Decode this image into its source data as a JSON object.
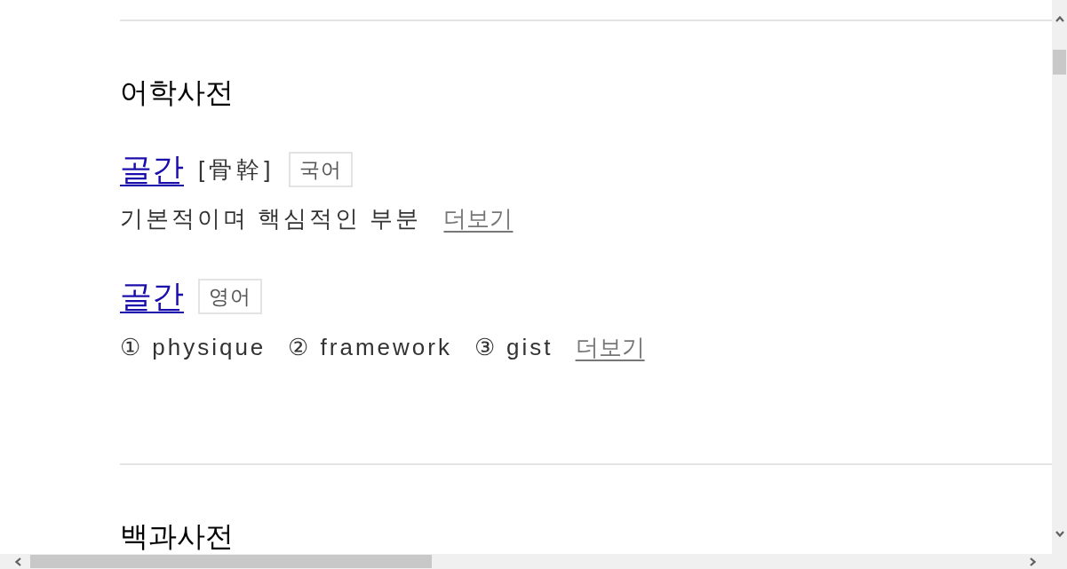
{
  "sections": [
    {
      "title": "어학사전",
      "entries": [
        {
          "headword": "골간",
          "hanja": "[骨幹]",
          "language": "국어",
          "senses": [
            "기본적이며 핵심적인 부분"
          ],
          "more_link": "더보기"
        },
        {
          "headword": "골간",
          "language": "영어",
          "senses": [
            "① physique",
            "② framework",
            "③ gist"
          ],
          "more_link": "더보기"
        }
      ]
    },
    {
      "title": "백과사전"
    }
  ]
}
